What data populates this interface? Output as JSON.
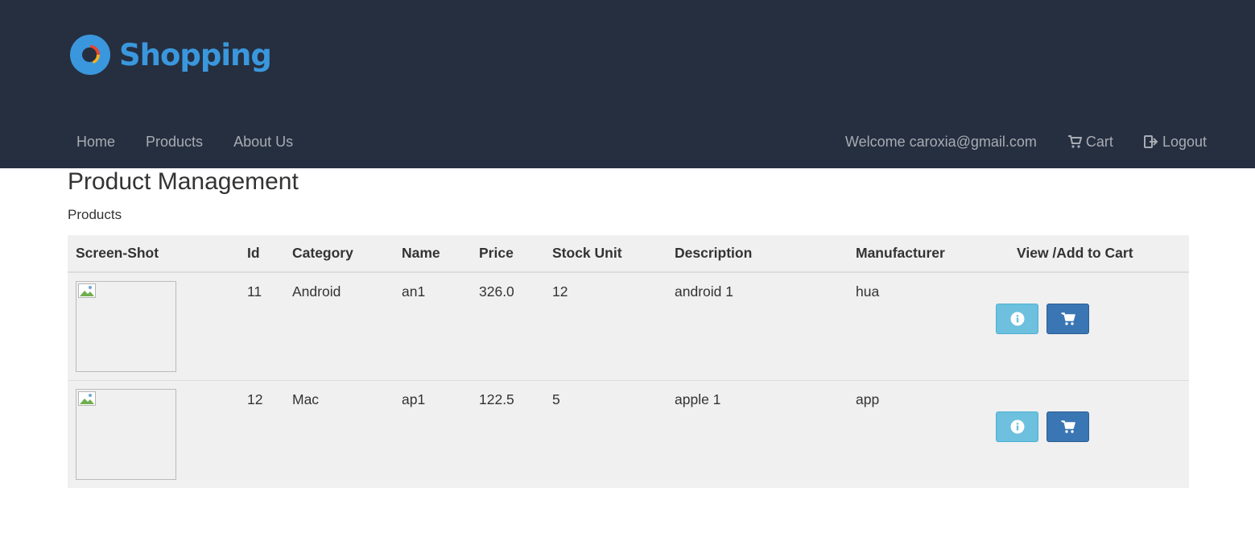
{
  "brand": {
    "name": "Shopping"
  },
  "nav": {
    "left": [
      "Home",
      "Products",
      "About Us"
    ],
    "welcome": "Welcome caroxia@gmail.com",
    "cart": "Cart",
    "logout": "Logout"
  },
  "page": {
    "title": "Product Management",
    "subtitle": "Products"
  },
  "table": {
    "headers": [
      "Screen-Shot",
      "Id",
      "Category",
      "Name",
      "Price",
      "Stock Unit",
      "Description",
      "Manufacturer",
      "View /Add to Cart"
    ],
    "rows": [
      {
        "id": "11",
        "category": "Android",
        "name": "an1",
        "price": "326.0",
        "stock": "12",
        "description": "android 1",
        "manufacturer": "hua"
      },
      {
        "id": "12",
        "category": "Mac",
        "name": "ap1",
        "price": "122.5",
        "stock": "5",
        "description": "apple 1",
        "manufacturer": "app"
      }
    ]
  },
  "colors": {
    "header_bg": "#252f40",
    "brand_blue": "#3a97dd",
    "info_btn": "#6dc0de",
    "primary_btn": "#3a76b4"
  },
  "icons": [
    "logo-icon",
    "cart-icon",
    "logout-icon",
    "info-icon",
    "broken-image-icon"
  ]
}
